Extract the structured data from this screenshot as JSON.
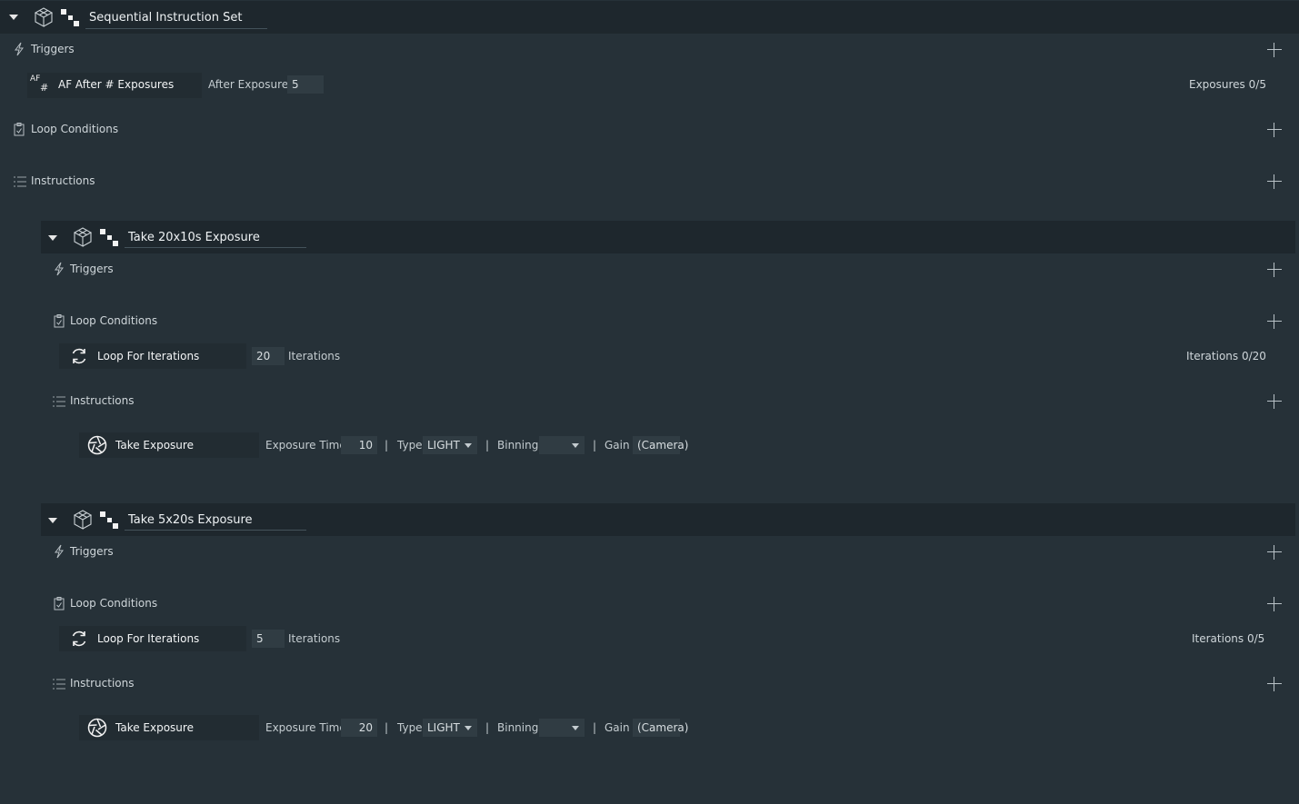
{
  "root": {
    "title": "Sequential Instruction Set",
    "triggers_label": "Triggers",
    "trigger_item": {
      "icon_text": "AF",
      "icon_text2": "#",
      "label": "AF After # Exposures",
      "field_label": "After Exposures",
      "field_value": "5",
      "status_label": "Exposures",
      "status_value": "0/5"
    },
    "loop_label": "Loop Conditions",
    "instructions_label": "Instructions"
  },
  "sets": [
    {
      "title": "Take 20x10s Exposure",
      "triggers_label": "Triggers",
      "loop_label": "Loop Conditions",
      "loop_item": {
        "label": "Loop For Iterations",
        "value": "20",
        "unit": "Iterations",
        "status_label": "Iterations",
        "status_value": "0/20"
      },
      "instructions_label": "Instructions",
      "exposure": {
        "label": "Take Exposure",
        "time_label": "Exposure Time",
        "time_value": "10",
        "type_label": "Type",
        "type_value": "LIGHT",
        "binning_label": "Binning",
        "binning_value": "",
        "gain_label": "Gain",
        "gain_value": "(Camera)",
        "sep": "|"
      }
    },
    {
      "title": "Take 5x20s Exposure",
      "triggers_label": "Triggers",
      "loop_label": "Loop Conditions",
      "loop_item": {
        "label": "Loop For Iterations",
        "value": "5",
        "unit": "Iterations",
        "status_label": "Iterations",
        "status_value": "0/5"
      },
      "instructions_label": "Instructions",
      "exposure": {
        "label": "Take Exposure",
        "time_label": "Exposure Time",
        "time_value": "20",
        "type_label": "Type",
        "type_value": "LIGHT",
        "binning_label": "Binning",
        "binning_value": "",
        "gain_label": "Gain",
        "gain_value": "(Camera)",
        "sep": "|"
      }
    }
  ]
}
